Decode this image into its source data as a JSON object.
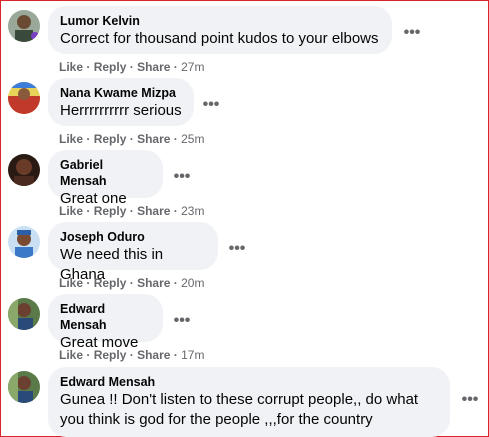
{
  "actions": {
    "like": "Like",
    "reply": "Reply",
    "share": "Share",
    "separator": "·"
  },
  "more_glyph": "•••",
  "comments": [
    {
      "name": "Lumor Kelvin",
      "text": "Correct for thousand point kudos to your elbows",
      "time": "27m"
    },
    {
      "name": "Nana Kwame Mizpa",
      "text": "Herrrrrrrrrr serious",
      "time": "25m"
    },
    {
      "name": "Gabriel Mensah",
      "text": "Great one",
      "time": "23m"
    },
    {
      "name": "Joseph Oduro",
      "text": "We need this in Ghana",
      "time": "20m"
    },
    {
      "name": "Edward Mensah",
      "text": "Great move",
      "time": "17m"
    },
    {
      "name": "Edward Mensah",
      "text": "Gunea !! Don't listen to these corrupt people,, do what you think is god for the people ,,,for the country",
      "time": ""
    }
  ],
  "colors": {
    "bubble": "#f0f2f5",
    "meta": "#65676b",
    "text": "#050505",
    "border": "#d9242a"
  }
}
